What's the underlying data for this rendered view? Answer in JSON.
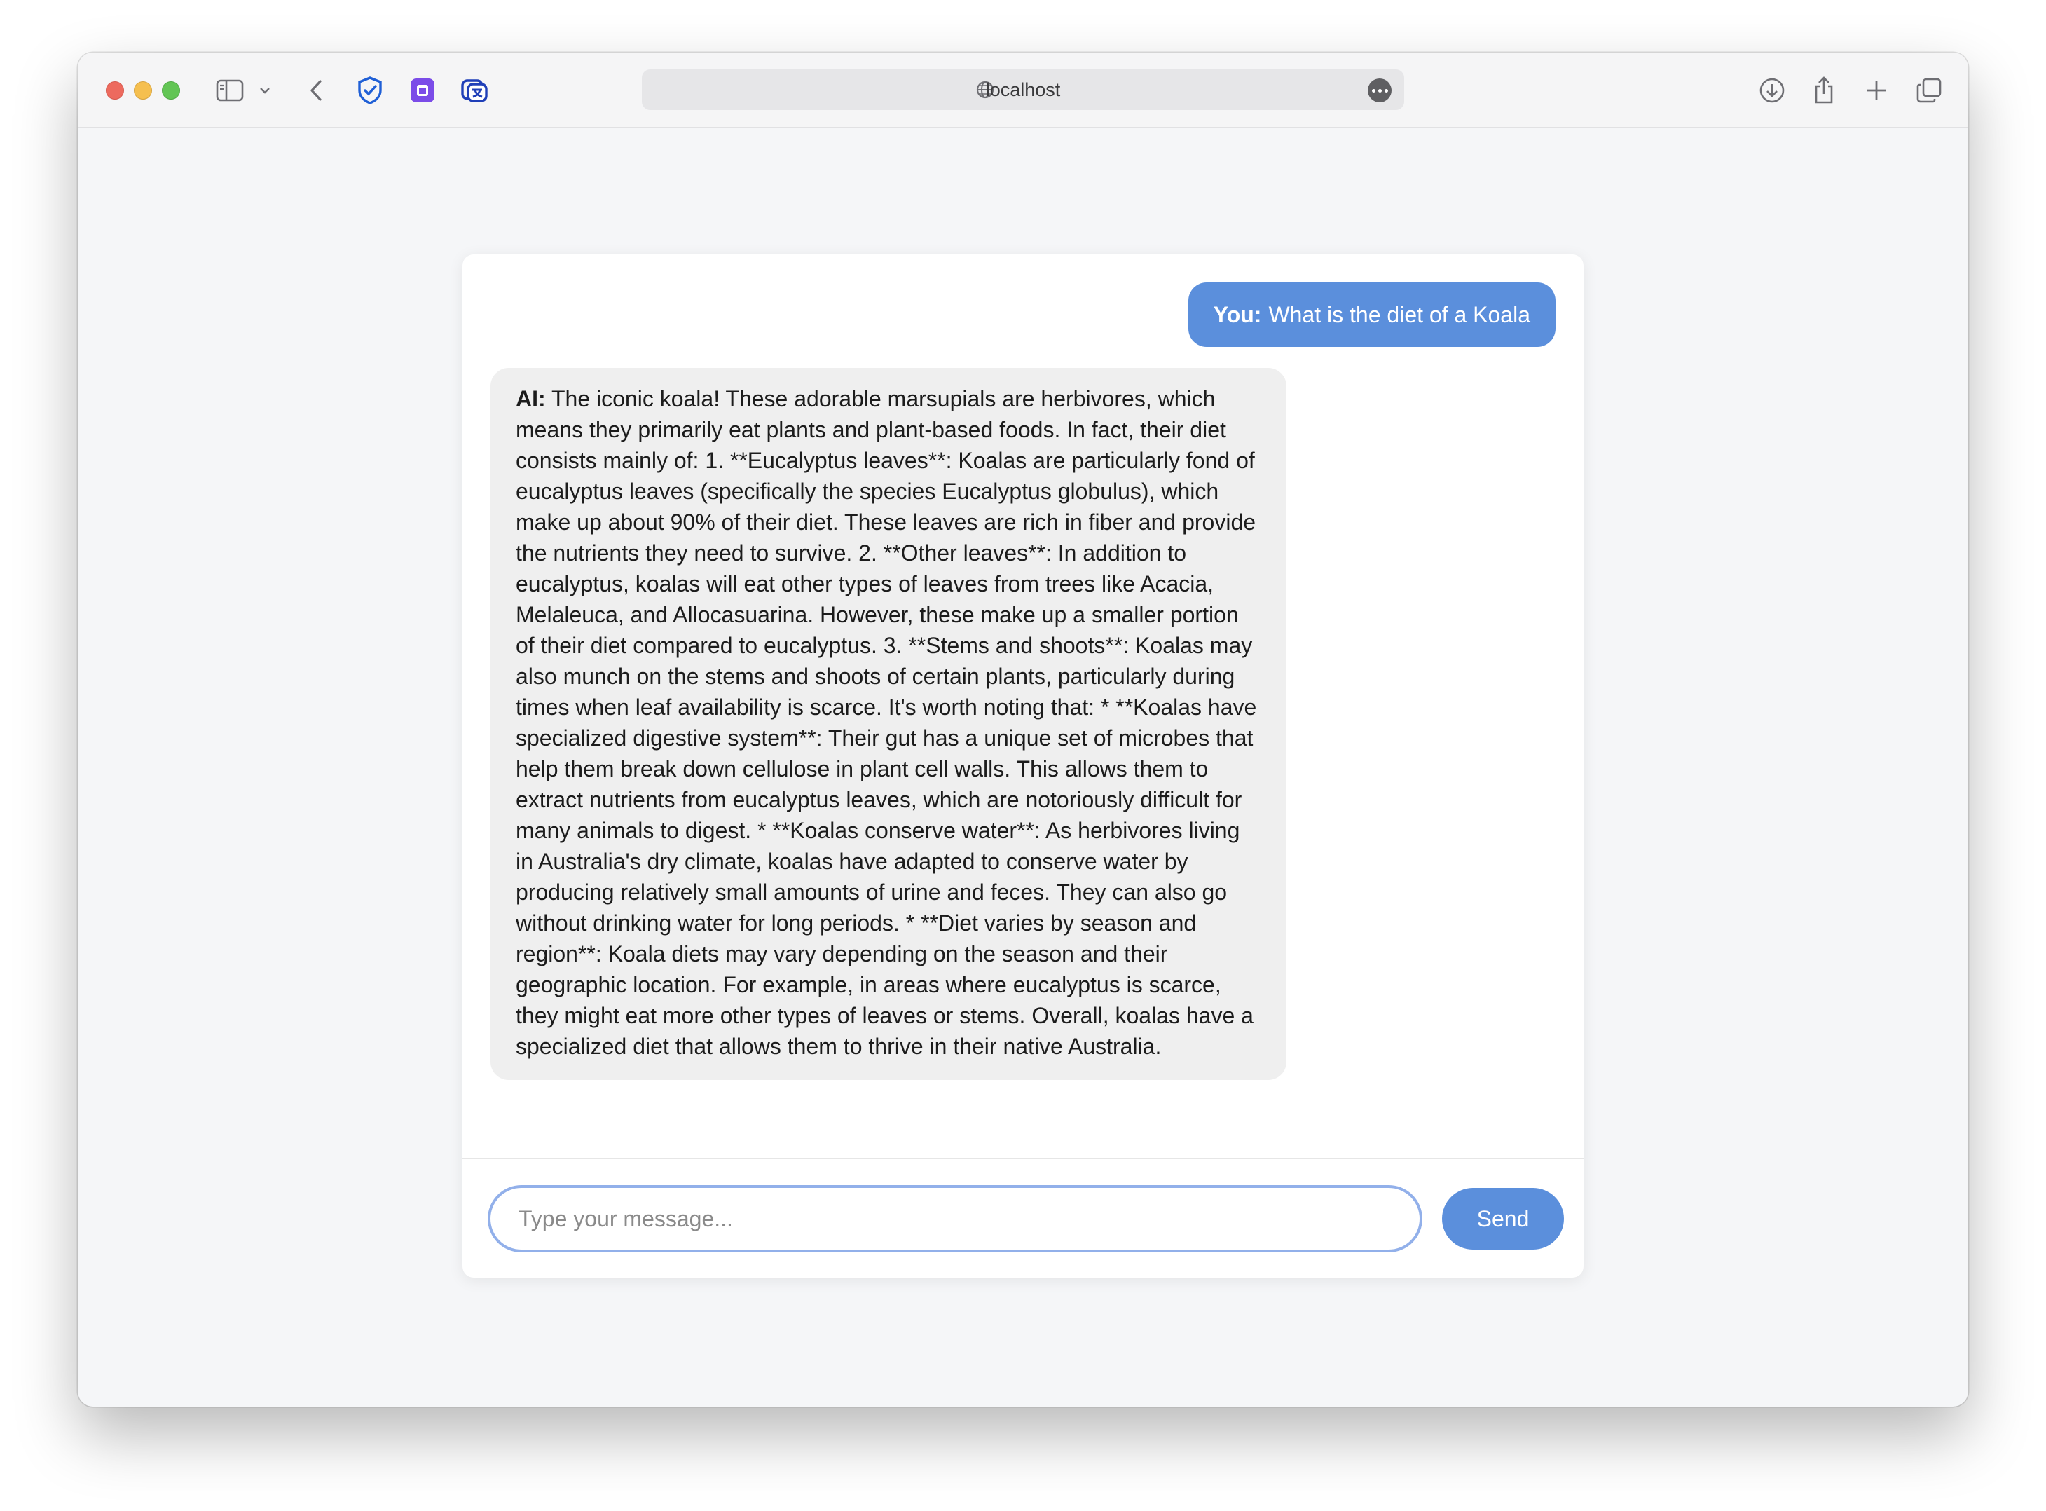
{
  "browser": {
    "url": "localhost",
    "icons": [
      "sidebar-toggle-icon",
      "chevron-down-icon",
      "back-icon",
      "shield-extension-icon",
      "calendar-extension-icon",
      "translate-extension-icon",
      "globe-icon",
      "more-icon",
      "download-icon",
      "share-icon",
      "new-tab-icon",
      "tabs-overview-icon"
    ]
  },
  "chat": {
    "user_message": {
      "speaker": "You:",
      "text": "What is the diet of a Koala"
    },
    "ai_message": {
      "speaker": "AI:",
      "text": "The iconic koala! These adorable marsupials are herbivores, which means they primarily eat plants and plant-based foods. In fact, their diet consists mainly of: 1. **Eucalyptus leaves**: Koalas are particularly fond of eucalyptus leaves (specifically the species Eucalyptus globulus), which make up about 90% of their diet. These leaves are rich in fiber and provide the nutrients they need to survive. 2. **Other leaves**: In addition to eucalyptus, koalas will eat other types of leaves from trees like Acacia, Melaleuca, and Allocasuarina. However, these make up a smaller portion of their diet compared to eucalyptus. 3. **Stems and shoots**: Koalas may also munch on the stems and shoots of certain plants, particularly during times when leaf availability is scarce. It's worth noting that: * **Koalas have specialized digestive system**: Their gut has a unique set of microbes that help them break down cellulose in plant cell walls. This allows them to extract nutrients from eucalyptus leaves, which are notoriously difficult for many animals to digest. * **Koalas conserve water**: As herbivores living in Australia's dry climate, koalas have adapted to conserve water by producing relatively small amounts of urine and feces. They can also go without drinking water for long periods. * **Diet varies by season and region**: Koala diets may vary depending on the season and their geographic location. For example, in areas where eucalyptus is scarce, they might eat more other types of leaves or stems. Overall, koalas have a specialized diet that allows them to thrive in their native Australia."
    },
    "input": {
      "value": "",
      "placeholder": "Type your message..."
    },
    "send_label": "Send"
  },
  "colors": {
    "accent": "#5b8fdc",
    "input_focus_border": "#92b0ea",
    "ai_bubble_bg": "#efefef",
    "page_bg": "#f5f6f8"
  }
}
